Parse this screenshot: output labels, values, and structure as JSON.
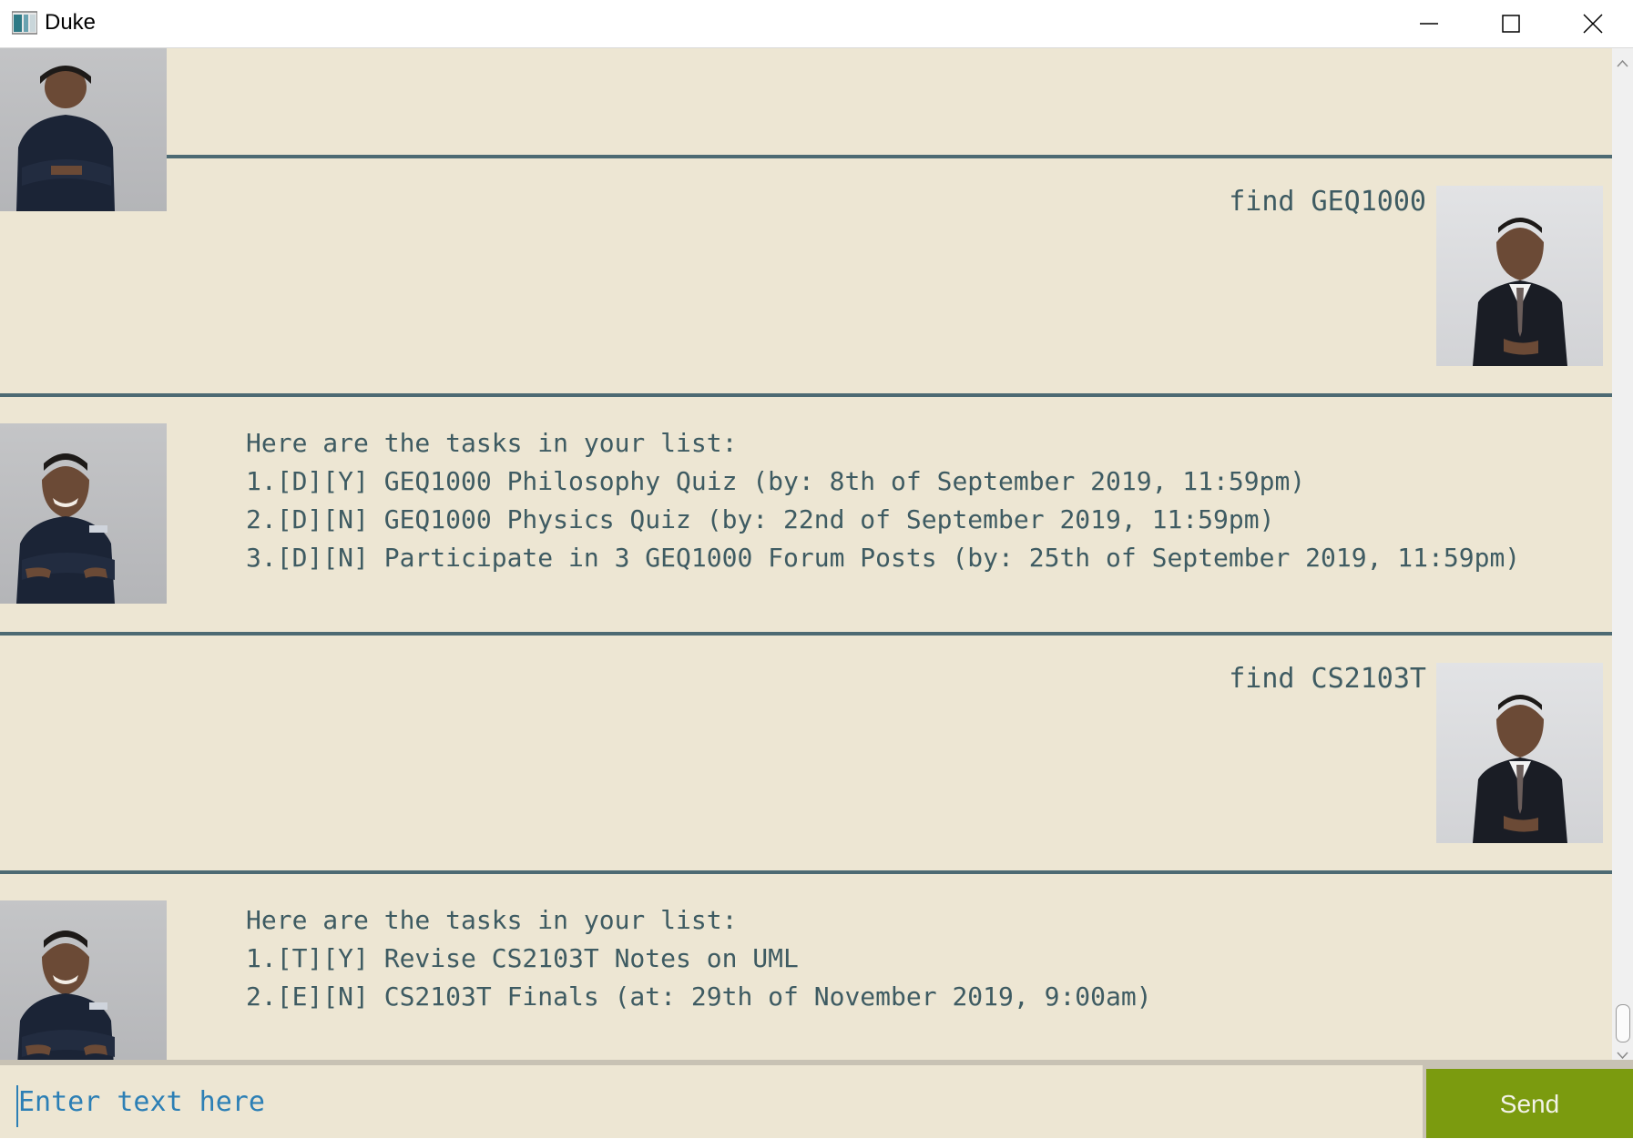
{
  "window": {
    "title": "Duke",
    "icon": "window-app-icon",
    "controls": [
      "minimize-icon",
      "maximize-icon",
      "close-icon"
    ]
  },
  "dialog": [
    {
      "speaker": "user",
      "text": "find GEQ1000"
    },
    {
      "speaker": "duke",
      "lines": [
        "Here are the tasks in your list:",
        "1.[D][Y] GEQ1000 Philosophy Quiz (by: 8th of September 2019, 11:59pm)",
        "2.[D][N] GEQ1000 Physics Quiz (by: 22nd of September 2019, 11:59pm)",
        "3.[D][N] Participate in 3 GEQ1000 Forum Posts (by: 25th of September 2019, 11:59pm)"
      ]
    },
    {
      "speaker": "user",
      "text": "find CS2103T"
    },
    {
      "speaker": "duke",
      "lines": [
        "Here are the tasks in your list:",
        "1.[T][Y] Revise CS2103T Notes on UML",
        "2.[E][N] CS2103T Finals (at: 29th of November 2019, 9:00am)"
      ]
    }
  ],
  "input": {
    "placeholder": "Enter text here",
    "value": ""
  },
  "send_button": {
    "label": "Send"
  },
  "colors": {
    "dialog_background": "#ede6d3",
    "divider": "#4d6a73",
    "text": "#3e5b62",
    "input_text": "#2c7fb5",
    "send_button": "#7b9b0f"
  }
}
